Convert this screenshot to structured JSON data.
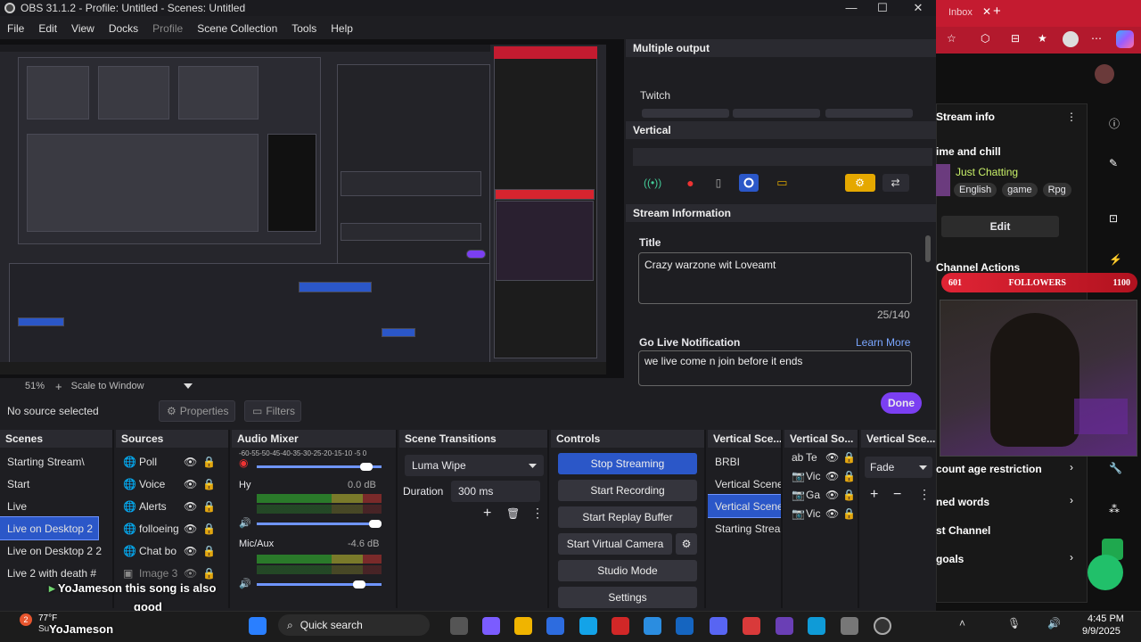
{
  "window": {
    "title": "OBS 31.1.2 - Profile: Untitled - Scenes: Untitled",
    "minimize": "—",
    "maximize": "☐",
    "close": "✕"
  },
  "menu": [
    "File",
    "Edit",
    "View",
    "Docks",
    "Profile",
    "Scene Collection",
    "Tools",
    "Help"
  ],
  "preview": {
    "zoom": "51%",
    "add": "+",
    "scale": "Scale to Window"
  },
  "source_bar": {
    "no_source": "No source selected",
    "properties": "Properties",
    "filters": "Filters"
  },
  "right_dock": {
    "multiple_output_title": "Multiple output",
    "multiple_output_line": "Twitch",
    "vertical_title": "Vertical",
    "stream_info_title": "Stream Information",
    "title_label": "Title",
    "title_value": "Crazy warzone wit Loveamt",
    "char_count": "25/140",
    "golive_label": "Go Live Notification",
    "learn_more": "Learn More",
    "golive_value": "we live come n join before it ends",
    "done": "Done"
  },
  "scenes": {
    "header": "Scenes",
    "items": [
      "Starting Stream\\",
      "Start",
      "Live",
      "Live on Desktop 2",
      "Live on Desktop 2 2",
      "Live 2 with death #"
    ],
    "selected": 3
  },
  "sources": {
    "header": "Sources",
    "items": [
      "Poll",
      "Voice",
      "Alerts",
      "folloeing",
      "Chat bo",
      "Image 3"
    ]
  },
  "mixer": {
    "header": "Audio Mixer",
    "scale": "-60-55-50-45-40-35-30-25-20-15-10 -5  0",
    "tracks": [
      {
        "name": "Hy",
        "db": "0.0 dB"
      },
      {
        "name": "Mic/Aux",
        "db": "-4.6 dB"
      }
    ],
    "levels": [
      0.88,
      0.95,
      0.82
    ]
  },
  "transitions": {
    "header": "Scene Transitions",
    "selected": "Luma Wipe",
    "duration_label": "Duration",
    "duration_value": "300 ms"
  },
  "controls": {
    "header": "Controls",
    "buttons": [
      "Stop Streaming",
      "Start Recording",
      "Start Replay Buffer",
      "Start Virtual Camera",
      "Studio Mode",
      "Settings"
    ]
  },
  "vertical_scenes": {
    "header": "Vertical Sce...",
    "items": [
      "BRBI",
      "Vertical Scene",
      "Vertical Scene",
      "Starting Stream"
    ],
    "selected": 2
  },
  "vertical_sources": {
    "header": "Vertical So...",
    "items": [
      "Te",
      "Vic",
      "Ga",
      "Vic"
    ]
  },
  "vertical_transitions": {
    "header": "Vertical Sce...",
    "selected": "Fade"
  },
  "browser": {
    "tab": "Inbox",
    "stream_info": "Stream info",
    "category_title": "ime and chill",
    "category": "Just Chatting",
    "tags": [
      "English",
      "game",
      "Rpg"
    ],
    "edit": "Edit",
    "channel_actions": "Channel Actions",
    "followers_left": "601",
    "followers_label": "FOLLOWERS",
    "followers_right": "1100",
    "rows": [
      "count age restriction",
      "ned words",
      "st Channel",
      "goals"
    ]
  },
  "chat": {
    "user": "YoJameson",
    "msg": "this song is also",
    "msg2": "good"
  },
  "taskbar": {
    "weather_temp": "77°F",
    "weather_loc": "Su",
    "search": "Quick search",
    "time": "4:45 PM",
    "date": "9/9/2025",
    "badge": "2"
  },
  "colors": {
    "accent": "#2b57c8",
    "done": "#7b3ff2",
    "brand_red": "#c41b30"
  }
}
